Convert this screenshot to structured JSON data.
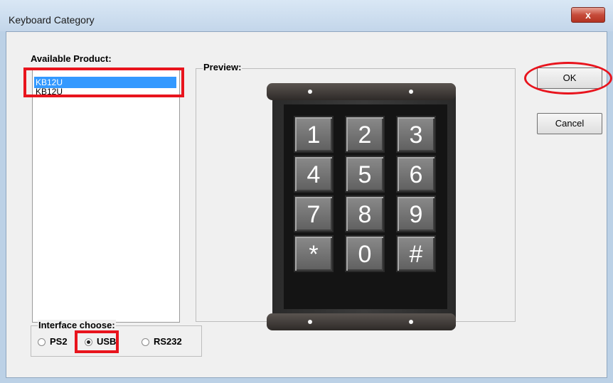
{
  "window": {
    "title": "Keyboard Category",
    "close_glyph": "x"
  },
  "products": {
    "label": "Available Product:",
    "items": [
      {
        "label": "KB12U",
        "selected": true
      },
      {
        "label": "KB12U",
        "selected": false
      }
    ]
  },
  "preview": {
    "label": "Preview:"
  },
  "keypad": {
    "keys": [
      "1",
      "2",
      "3",
      "4",
      "5",
      "6",
      "7",
      "8",
      "9",
      "*",
      "0",
      "#"
    ]
  },
  "buttons": {
    "ok": "OK",
    "cancel": "Cancel"
  },
  "interface": {
    "label": "Interface choose:",
    "options": [
      {
        "label": "PS2",
        "checked": false
      },
      {
        "label": "USB",
        "checked": true
      },
      {
        "label": "RS232",
        "checked": false
      }
    ]
  },
  "colors": {
    "highlight": "#e8141d",
    "selection": "#3399ff"
  }
}
